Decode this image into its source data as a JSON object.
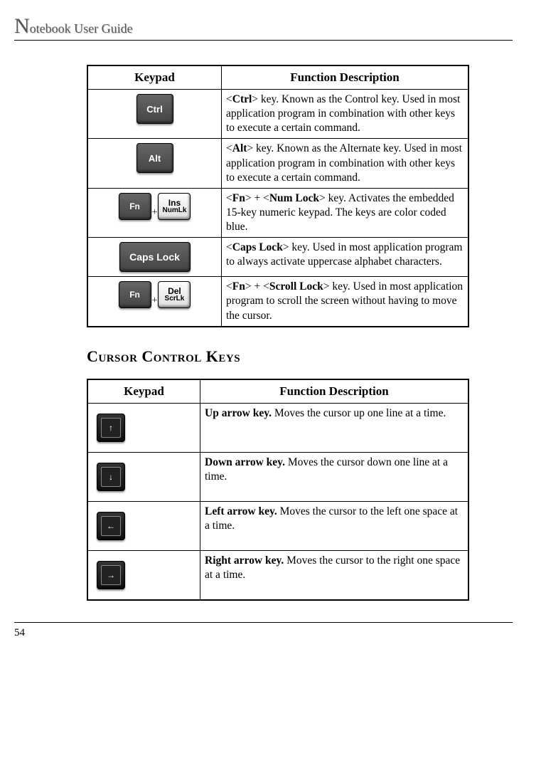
{
  "header": {
    "title_prefix": "N",
    "title_rest": "otebook User Guide"
  },
  "table1": {
    "head": {
      "keypad": "Keypad",
      "desc": "Function Description"
    },
    "rows": [
      {
        "key_labels": [
          {
            "style": "dark med",
            "text": "Ctrl"
          }
        ],
        "key_bold_parts": [
          "Ctrl"
        ],
        "desc_segments": [
          "<",
          "Ctrl",
          "> key. Known as the Control key. Used in most application program in combination with other keys to execute a certain command."
        ]
      },
      {
        "key_labels": [
          {
            "style": "dark med",
            "text": "Alt"
          }
        ],
        "desc_segments": [
          "<",
          "Alt",
          "> key. Known as the Alternate key. Used in most application program in combination with other keys to execute a certain command."
        ]
      },
      {
        "key_labels": [
          {
            "style": "dark small",
            "text": "Fn"
          },
          {
            "plus": true
          },
          {
            "style": "light small",
            "stack": {
              "top": "Ins",
              "bot": "NumLk"
            }
          }
        ],
        "desc_segments": [
          "<",
          "Fn",
          "> + <",
          "Num Lock",
          "> key. Activates the embedded 15-key numeric keypad. The keys are color coded blue."
        ]
      },
      {
        "key_labels": [
          {
            "style": "dark wide",
            "text": "Caps Lock"
          }
        ],
        "desc_segments": [
          "<",
          "Caps Lock",
          "> key. Used in most application program to always activate uppercase alphabet characters."
        ]
      },
      {
        "key_labels": [
          {
            "style": "dark small",
            "text": "Fn"
          },
          {
            "plus": true
          },
          {
            "style": "light small",
            "stack": {
              "top": "Del",
              "bot": "ScrLk"
            }
          }
        ],
        "desc_segments": [
          "<",
          "Fn",
          "> + <",
          "Scroll Lock",
          "> key. Used in most application program to scroll the screen without having to move the cursor."
        ]
      }
    ]
  },
  "section_heading": "Cursor Control Keys",
  "table2": {
    "head": {
      "keypad": "Keypad",
      "desc": "Function Description"
    },
    "rows": [
      {
        "arrow": "↑",
        "bold": "Up arrow key.",
        "rest": " Moves the cursor up one line at a time."
      },
      {
        "arrow": "↓",
        "bold": "Down arrow key.",
        "rest": " Moves the cursor down one line at a time."
      },
      {
        "arrow": "←",
        "bold": "Left arrow key.",
        "rest": " Moves the cursor to the left one space at a time."
      },
      {
        "arrow": "→",
        "bold": "Right arrow key.",
        "rest": " Moves the cursor to the right one space at a time."
      }
    ]
  },
  "page_number": "54"
}
